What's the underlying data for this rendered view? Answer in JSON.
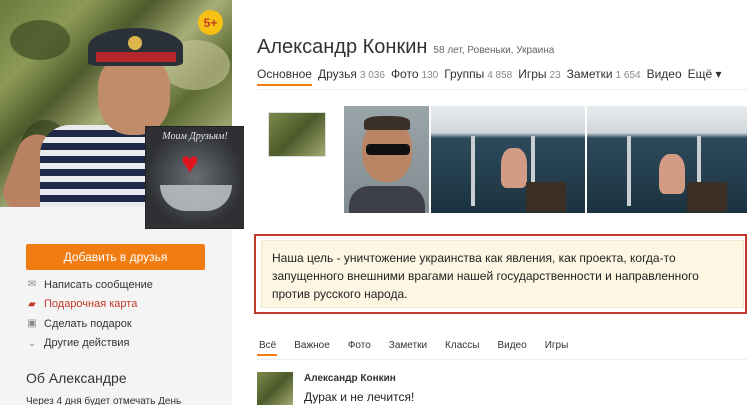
{
  "profile": {
    "badge": "5+",
    "name": "Александр Конкин",
    "meta": "58 лет, Ровеньки, Украина"
  },
  "sticker": {
    "caption": "Моим Друзьям!"
  },
  "sidebar": {
    "add_friend": "Добавить в друзья",
    "actions": [
      {
        "label": "Написать сообщение",
        "icon": "envelope-icon"
      },
      {
        "label": "Подарочная карта",
        "icon": "gift-card-icon"
      },
      {
        "label": "Сделать подарок",
        "icon": "gift-icon"
      },
      {
        "label": "Другие действия",
        "icon": "chevron-down-icon"
      }
    ],
    "about_title": "Об Александре",
    "about_line": "Через 4 дня будет отмечать День"
  },
  "tabs": [
    {
      "label": "Основное",
      "count": ""
    },
    {
      "label": "Друзья",
      "count": "3 036"
    },
    {
      "label": "Фото",
      "count": "130"
    },
    {
      "label": "Группы",
      "count": "4 858"
    },
    {
      "label": "Игры",
      "count": "23"
    },
    {
      "label": "Заметки",
      "count": "1 654"
    },
    {
      "label": "Видео",
      "count": ""
    },
    {
      "label": "Ещё ▾",
      "count": ""
    }
  ],
  "quote": {
    "text": "Наша цель - уничтожение украинства как явления, как проекта, когда-то запущенного внешними врагами нашей государственности и направленного против русского народа."
  },
  "feed_tabs": [
    "Всё",
    "Важное",
    "Фото",
    "Заметки",
    "Классы",
    "Видео",
    "Игры"
  ],
  "post": {
    "author": "Александр Конкин",
    "text": "Дурак и не лечится!"
  },
  "colors": {
    "accent": "#f07c12",
    "highlight_border": "#c0392b",
    "badge": "#f6c015"
  }
}
